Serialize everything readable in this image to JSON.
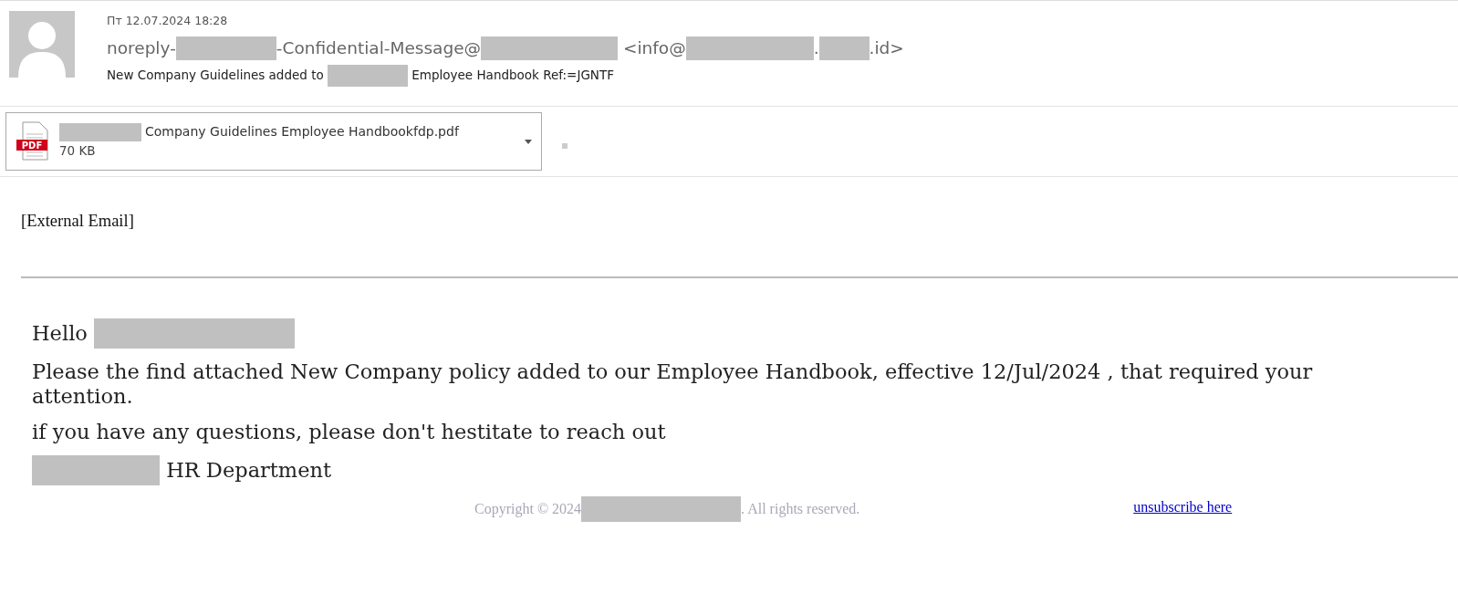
{
  "header": {
    "date": "Пт 12.07.2024 18:28",
    "sender": [
      {
        "kind": "text",
        "text": "noreply-"
      },
      {
        "kind": "redacted"
      },
      {
        "kind": "text",
        "text": "-Confidential-Message@"
      },
      {
        "kind": "redacted"
      },
      {
        "kind": "text",
        "text": " <info@"
      },
      {
        "kind": "redacted"
      },
      {
        "kind": "text",
        "text": "."
      },
      {
        "kind": "redacted"
      },
      {
        "kind": "text",
        "text": ".id>"
      }
    ],
    "subject": [
      {
        "kind": "text",
        "text": "New Company Guidelines added to "
      },
      {
        "kind": "redacted"
      },
      {
        "kind": "text",
        "text": " Employee Handbook Ref:=JGNTF"
      }
    ]
  },
  "attachment": {
    "name": [
      {
        "kind": "redacted"
      },
      {
        "kind": "text",
        "text": "Company Guidelines Employee Handbookfdp.pdf"
      }
    ],
    "size": "70 KB",
    "type_label": "PDF"
  },
  "body": {
    "banner": "[External Email]",
    "lines": [
      [
        {
          "kind": "text",
          "text": "Hello "
        },
        {
          "kind": "redacted"
        }
      ],
      [
        {
          "kind": "text",
          "text": "Please the find attached New Company policy added to our Employee Handbook, effective 12/Jul/2024 , that required your attention."
        }
      ],
      [
        {
          "kind": "text",
          "text": "if you have any questions, please don't hestitate to reach out"
        }
      ],
      [
        {
          "kind": "redacted"
        },
        {
          "kind": "text",
          "text": " HR Department"
        }
      ]
    ],
    "footer": {
      "copyright": [
        {
          "kind": "text",
          "text": "Copyright © 2024"
        },
        {
          "kind": "redacted"
        },
        {
          "kind": "text",
          "text": ". All rights reserved."
        }
      ],
      "unsubscribe": "unsubscribe here"
    }
  }
}
